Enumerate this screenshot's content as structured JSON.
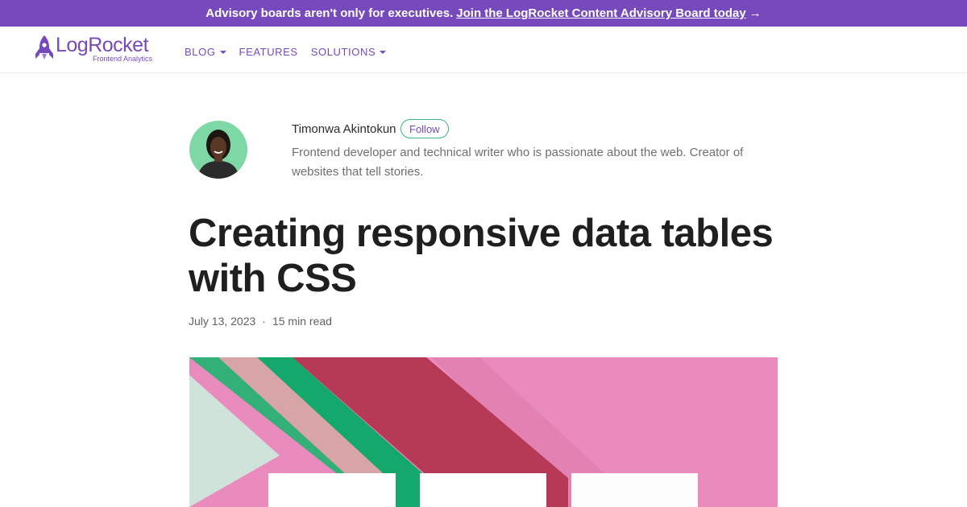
{
  "banner": {
    "text": "Advisory boards aren't only for executives.",
    "link": "Join the LogRocket Content Advisory Board today",
    "arrow": "→"
  },
  "logo": {
    "name": "LogRocket",
    "tagline": "Frontend Analytics",
    "icon": "rocket-icon"
  },
  "nav": {
    "items": [
      {
        "label": "BLOG",
        "dropdown": true
      },
      {
        "label": "FEATURES",
        "dropdown": false
      },
      {
        "label": "SOLUTIONS",
        "dropdown": true
      }
    ]
  },
  "author": {
    "name": "Timonwa Akintokun",
    "follow_label": "Follow",
    "bio": "Frontend developer and technical writer who is passionate about the web. Creator of websites that tell stories."
  },
  "article": {
    "title": "Creating responsive data tables with CSS",
    "date": "July 13, 2023",
    "separator": "·",
    "read_time": "15 min read"
  },
  "colors": {
    "brand": "#764abc",
    "follow_border": "#3bb28b",
    "hero_background": "#e98bbd"
  }
}
